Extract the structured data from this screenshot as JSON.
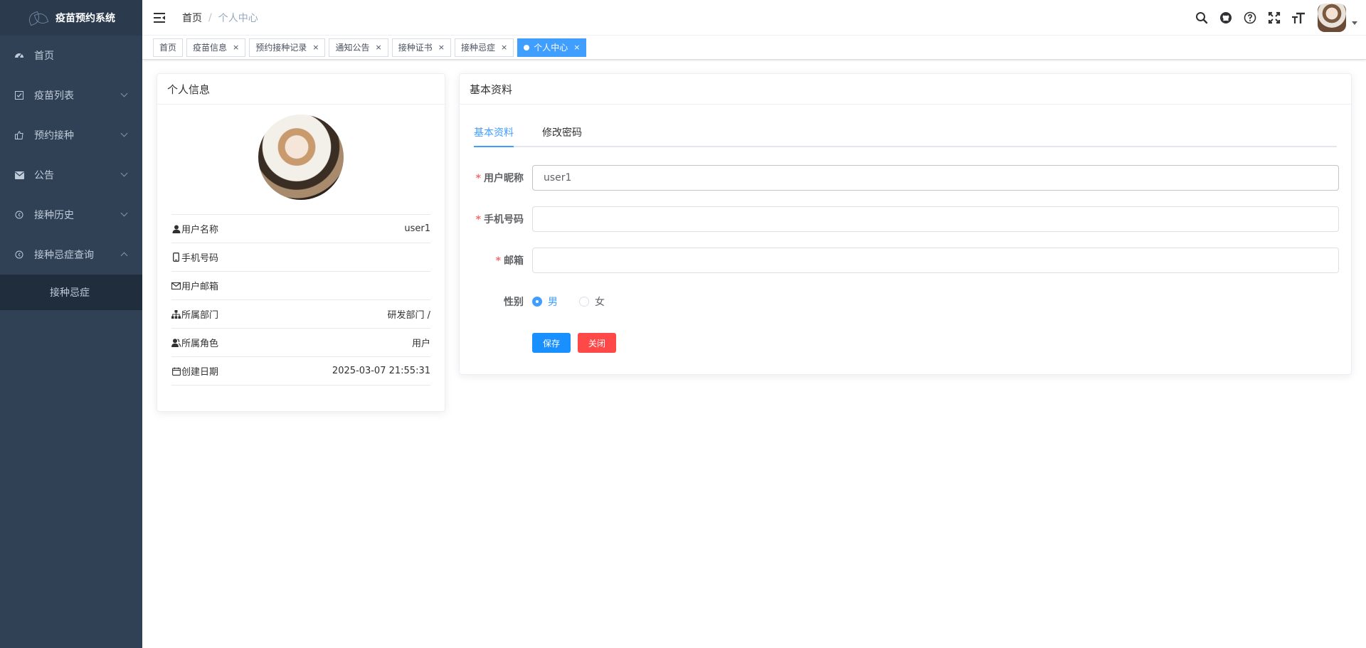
{
  "app": {
    "title": "疫苗预约系统"
  },
  "sidebar": {
    "items": [
      {
        "label": "首页",
        "icon": "dashboard-icon",
        "has_arrow": false
      },
      {
        "label": "疫苗列表",
        "icon": "checkbox-icon",
        "has_arrow": true
      },
      {
        "label": "预约接种",
        "icon": "thumb-icon",
        "has_arrow": true
      },
      {
        "label": "公告",
        "icon": "mail-icon",
        "has_arrow": true
      },
      {
        "label": "接种历史",
        "icon": "history-icon",
        "has_arrow": true
      },
      {
        "label": "接种忌症查询",
        "icon": "query-icon",
        "has_arrow": true,
        "expanded": true
      }
    ],
    "sub_items": [
      {
        "label": "接种忌症"
      }
    ]
  },
  "navbar": {
    "breadcrumb": {
      "home": "首页",
      "separator": "/",
      "current": "个人中心"
    },
    "icons": [
      "search-icon",
      "github-icon",
      "question-icon",
      "fullscreen-icon",
      "font-size-icon"
    ]
  },
  "tags": [
    {
      "label": "首页",
      "closable": false,
      "active": false
    },
    {
      "label": "疫苗信息",
      "closable": true,
      "active": false
    },
    {
      "label": "预约接种记录",
      "closable": true,
      "active": false
    },
    {
      "label": "通知公告",
      "closable": true,
      "active": false
    },
    {
      "label": "接种证书",
      "closable": true,
      "active": false
    },
    {
      "label": "接种忌症",
      "closable": true,
      "active": false
    },
    {
      "label": "个人中心",
      "closable": true,
      "active": true
    }
  ],
  "profile_card": {
    "title": "个人信息",
    "rows": [
      {
        "label": "用户名称",
        "value": "user1",
        "icon": "user-icon"
      },
      {
        "label": "手机号码",
        "value": "",
        "icon": "phone-icon"
      },
      {
        "label": "用户邮箱",
        "value": "",
        "icon": "email-icon"
      },
      {
        "label": "所属部门",
        "value": "研发部门 /",
        "icon": "tree-icon"
      },
      {
        "label": "所属角色",
        "value": "用户",
        "icon": "peoples-icon"
      },
      {
        "label": "创建日期",
        "value": "2025-03-07 21:55:31",
        "icon": "date-icon"
      }
    ]
  },
  "basic_card": {
    "title": "基本资料",
    "tabs": [
      {
        "label": "基本资料",
        "active": true
      },
      {
        "label": "修改密码",
        "active": false
      }
    ],
    "form": {
      "nickname_label": "用户昵称",
      "nickname_value": "user1",
      "phone_label": "手机号码",
      "phone_value": "",
      "email_label": "邮箱",
      "email_value": "",
      "gender_label": "性别",
      "gender_options": [
        {
          "label": "男",
          "checked": true
        },
        {
          "label": "女",
          "checked": false
        }
      ],
      "save_label": "保存",
      "close_label": "关闭",
      "required_mark": "*"
    }
  },
  "colors": {
    "sidebar_bg": "#304156",
    "primary": "#409eff",
    "danger": "#ff4949"
  }
}
